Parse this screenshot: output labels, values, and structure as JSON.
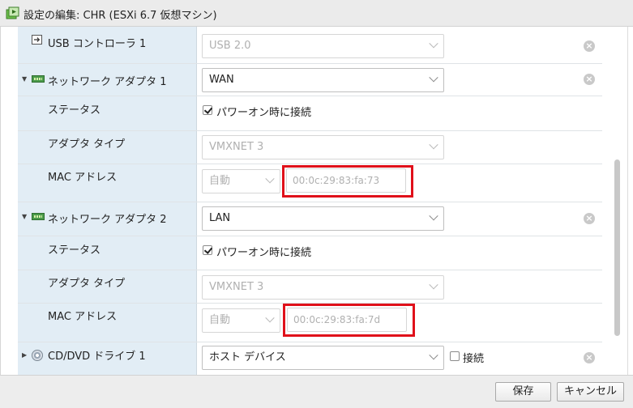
{
  "window": {
    "title": "設定の編集: CHR (ESXi 6.7 仮想マシン)"
  },
  "usb": {
    "label": "USB コントローラ 1",
    "value": "USB 2.0",
    "remove_icon": "x-circle-icon"
  },
  "nic1": {
    "label": "ネットワーク アダプタ 1",
    "network": "WAN",
    "status_label": "ステータス",
    "connect_label": "パワーオン時に接続",
    "connect_checked": true,
    "type_label": "アダプタ タイプ",
    "type_value": "VMXNET 3",
    "mac_label": "MAC アドレス",
    "mac_mode": "自動",
    "mac_address": "00:0c:29:83:fa:73"
  },
  "nic2": {
    "label": "ネットワーク アダプタ 2",
    "network": "LAN",
    "status_label": "ステータス",
    "connect_label": "パワーオン時に接続",
    "connect_checked": true,
    "type_label": "アダプタ タイプ",
    "type_value": "VMXNET 3",
    "mac_label": "MAC アドレス",
    "mac_mode": "自動",
    "mac_address": "00:0c:29:83:fa:7d"
  },
  "cdrom": {
    "label": "CD/DVD ドライブ 1",
    "value": "ホスト デバイス",
    "connect_label": "接続",
    "connect_checked": false
  },
  "footer": {
    "save_label": "保存",
    "cancel_label": "キャンセル"
  },
  "colors": {
    "highlight": "#e0101a",
    "label_column": "#e2edf5"
  }
}
